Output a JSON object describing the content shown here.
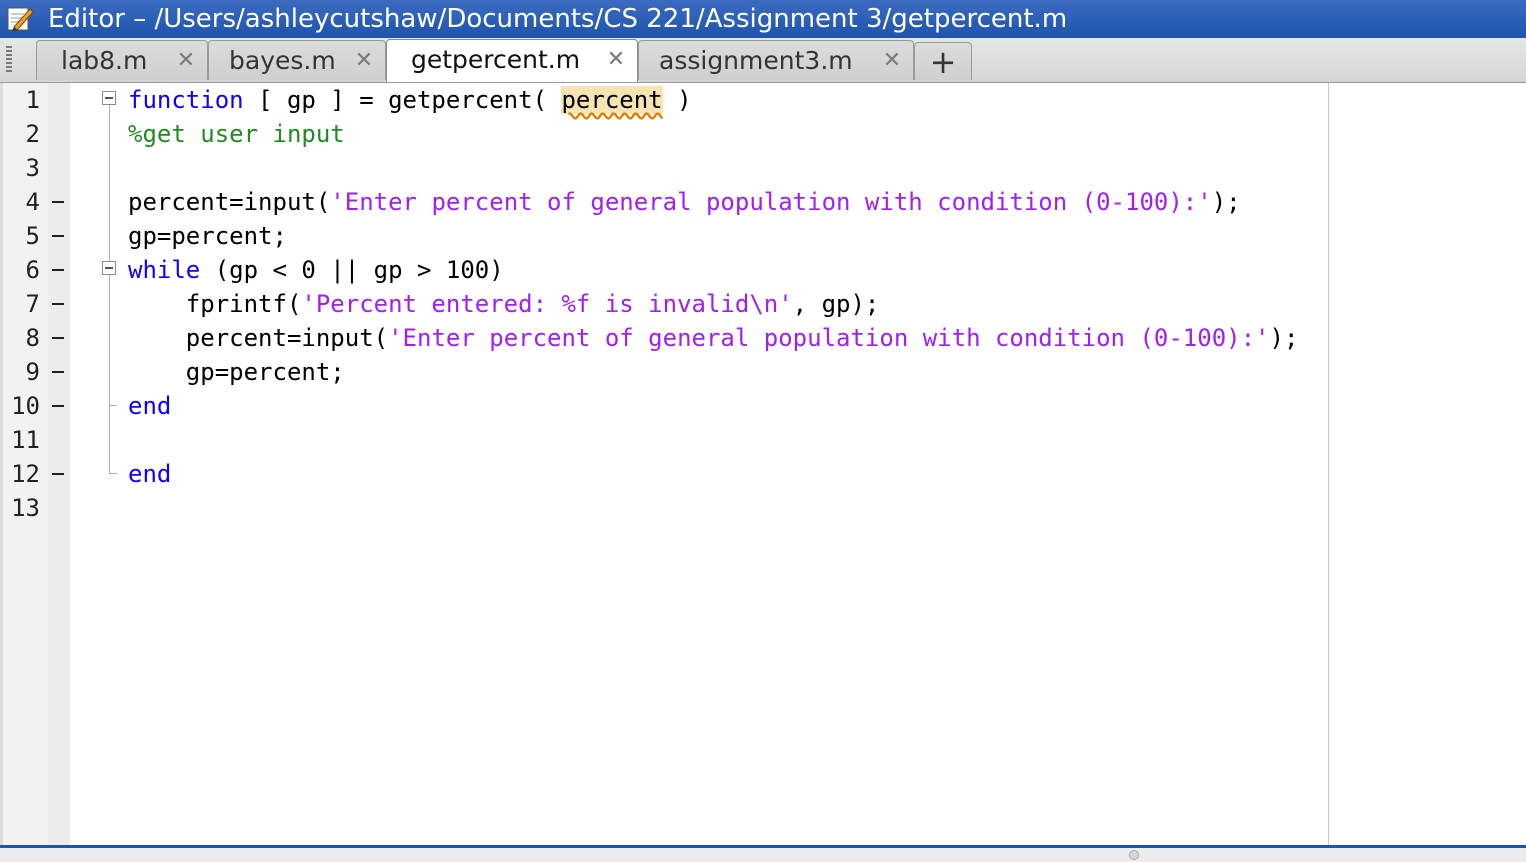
{
  "window": {
    "title": "Editor – /Users/ashleycutshaw/Documents/CS 221/Assignment 3/getpercent.m",
    "icon": "editor-pencil-icon"
  },
  "tabs": [
    {
      "label": "lab8.m",
      "active": false
    },
    {
      "label": "bayes.m",
      "active": false
    },
    {
      "label": "getpercent.m",
      "active": true
    },
    {
      "label": "assignment3.m",
      "active": false
    }
  ],
  "tab_close_glyph": "✕",
  "new_tab_label": "+",
  "line_numbers": [
    "1",
    "2",
    "3",
    "4",
    "5",
    "6",
    "7",
    "8",
    "9",
    "10",
    "11",
    "12",
    "13"
  ],
  "code": {
    "l1_kw": "function",
    "l1_mid": " [ gp ] = getpercent( ",
    "l1_arg": "percent",
    "l1_end": " )",
    "l2_comment": "%get user input",
    "l4_pre": "percent=input(",
    "l4_str": "'Enter percent of general population with condition (0-100):'",
    "l4_post": ");",
    "l5": "gp=percent;",
    "l6_kw": "while",
    "l6_rest": " (gp < 0 || gp > 100)",
    "l7_pre": "    fprintf(",
    "l7_str": "'Percent entered: %f is invalid\\n'",
    "l7_post": ", gp);",
    "l8_pre": "    percent=input(",
    "l8_str": "'Enter percent of general population with condition (0-100):'",
    "l8_post": ");",
    "l9": "    gp=percent;",
    "l10_kw": "end",
    "l12_kw": "end"
  },
  "colors": {
    "keyword": "#0e00ff",
    "comment": "#228b22",
    "string": "#a020f0",
    "titlebar": "#1f54ad",
    "highlight": "#f7e4b3"
  }
}
